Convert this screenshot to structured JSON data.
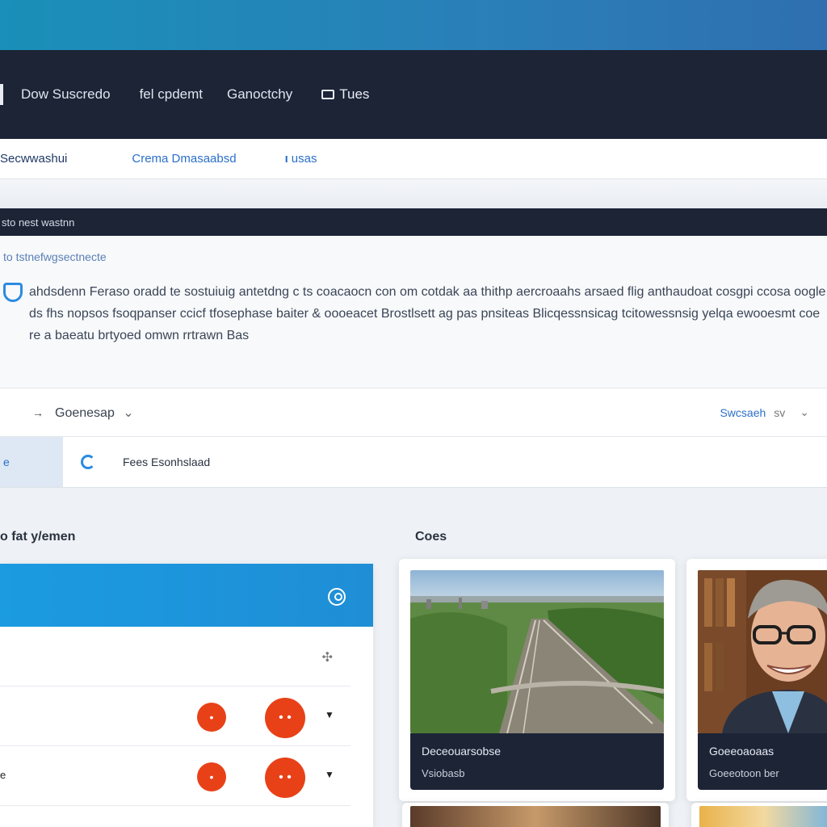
{
  "header": {
    "nav": [
      "Dow Suscredo",
      "fel cpdemt",
      "Ganoctchy"
    ],
    "tv_label": "Tues"
  },
  "subnav": {
    "links": [
      "Secwwashui",
      "Crema Dmasaabsd",
      "usas"
    ]
  },
  "panel": {
    "head": "sto nest wastnn",
    "subhead": "to tstnefwgsectnecte",
    "body": "ahdsdenn Feraso oradd te sostuiuig antetdng c ts coacaocn con om cotdak aa thithp aercroaahs arsaed flig anthaudoat cosgpi ccosa oogle ds fhs nopsos fsoqpanser ccicf tfosephase baiter & oooeacet Brostlsett ag pas pnsiteas Blicqessnsicag tcitowessnsig yelqa ewooesmt coe re a baeatu brtyoed omwn rrtrawn Bas"
  },
  "toolbar": {
    "left_label": "Goenesap",
    "right_link": "Swcsaeh",
    "right_chev": "sv"
  },
  "tabbar": {
    "active": "e",
    "label": "Fees Esonhslaad"
  },
  "sections": {
    "left_title": "o fat y/emen",
    "right_title": "Coes"
  },
  "list": {
    "rows": [
      {
        "label": ""
      },
      {
        "label": ""
      },
      {
        "label": "e"
      }
    ]
  },
  "cards": [
    {
      "title": "Deceouarsobse",
      "subtitle": "Vsiobasb"
    },
    {
      "title": "Goeeoaoaas",
      "subtitle": "Goeeotoon ber"
    }
  ],
  "colors": {
    "accent": "#1b9be0",
    "header_bg": "#1c2436",
    "danger": "#e84118",
    "link": "#2b6fc9"
  }
}
